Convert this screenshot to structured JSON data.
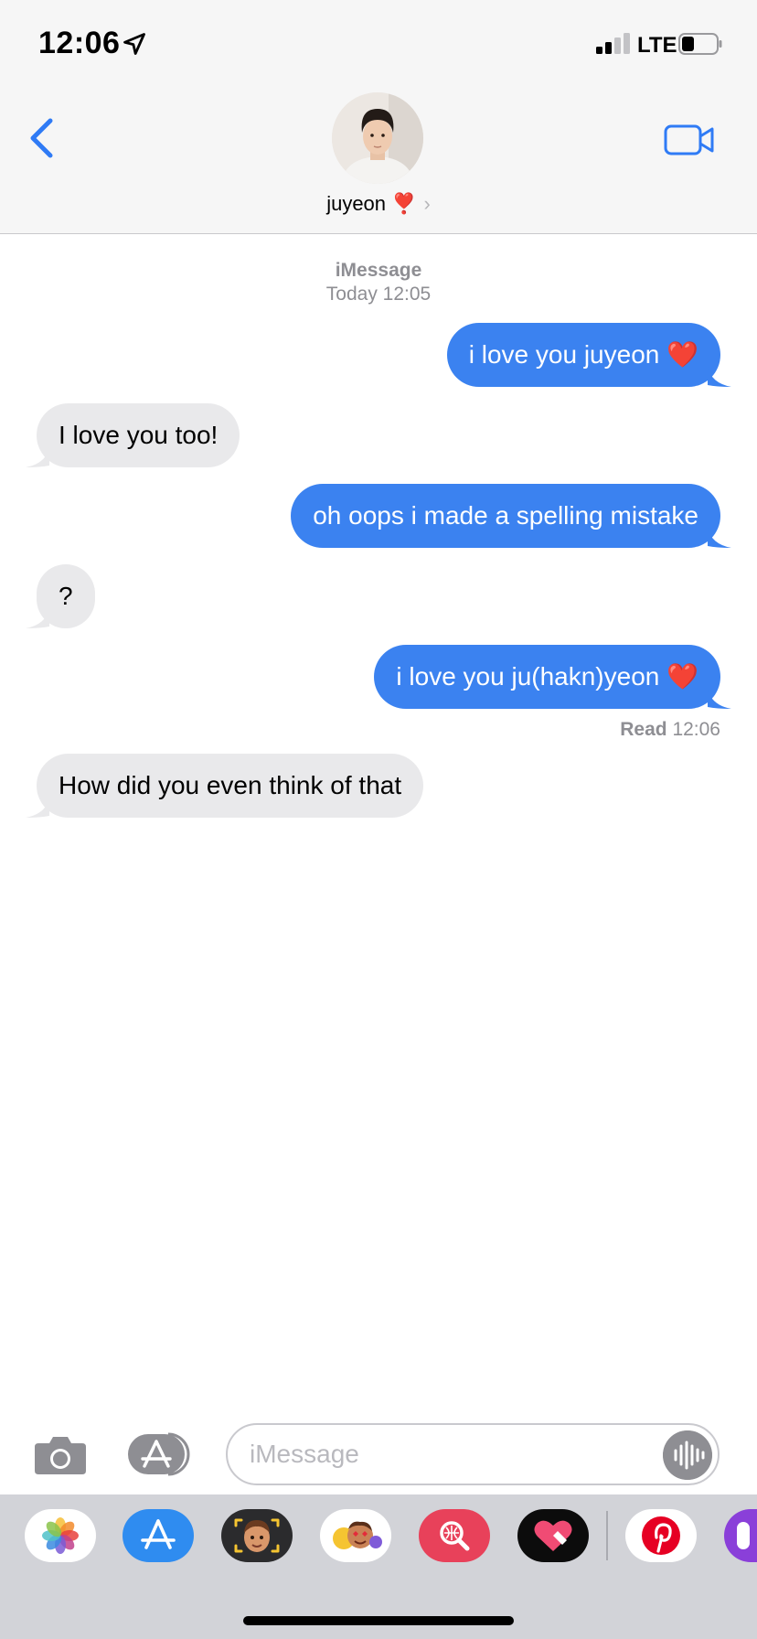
{
  "status_bar": {
    "time": "12:06",
    "network": "LTE"
  },
  "header": {
    "contact_name": "juyeon",
    "contact_emoji": "❣️",
    "chevron": "›"
  },
  "conversation": {
    "service": "iMessage",
    "timestamp": "Today 12:05",
    "messages": [
      {
        "direction": "sent",
        "text": "i love you juyeon ❤️"
      },
      {
        "direction": "received",
        "text": "I love you too!"
      },
      {
        "direction": "sent",
        "text": "oh oops i made a spelling mistake"
      },
      {
        "direction": "received",
        "text": "?"
      },
      {
        "direction": "sent",
        "text": "i love you ju(hakn)yeon ❤️"
      },
      {
        "direction": "received",
        "text": "How did you even think of that"
      }
    ],
    "read_receipt": {
      "label": "Read",
      "time": "12:06"
    }
  },
  "input_bar": {
    "placeholder": "iMessage"
  },
  "app_drawer": {
    "apps": [
      "photos",
      "app-store",
      "memoji",
      "animoji-stickers",
      "search-images",
      "digital-touch",
      "pinterest",
      "more-apps"
    ]
  },
  "colors": {
    "sent_bubble": "#3b82f0",
    "received_bubble": "#e9e9eb",
    "accent": "#2f7bf5"
  }
}
